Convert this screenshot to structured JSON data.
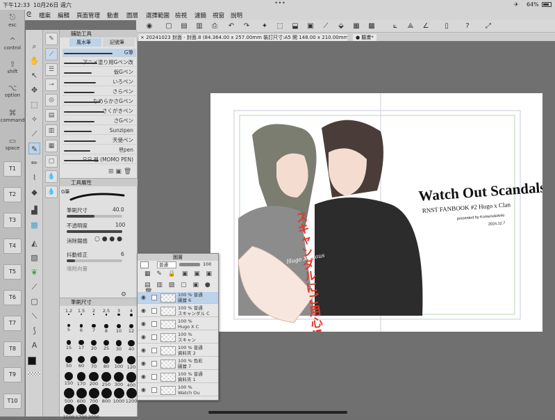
{
  "status": {
    "time": "下午12:33",
    "date": "10月26日 週六",
    "battery": "64%"
  },
  "menu": [
    "檔案",
    "編輯",
    "頁面管理",
    "動畫",
    "圖層",
    "選擇範圍",
    "檢視",
    "濾鏡",
    "視窗",
    "說明"
  ],
  "edge": {
    "esc": "esc",
    "control": "control",
    "shift": "shift",
    "option": "option",
    "command": "command",
    "space": "space",
    "t_buttons": [
      "T1",
      "T2",
      "T3",
      "T4",
      "T5",
      "T6",
      "T7",
      "T8",
      "T9",
      "T10"
    ]
  },
  "tab": {
    "title": "× 20241023 封面 - 封面.8 (84.364.00 x 257.00mm 裝訂尺寸:A5 開 148.00 x 210.00mm 350dpi 33.4%)",
    "nav": "● 聽畫*"
  },
  "brush_panel": {
    "header_tabs": [
      "輔助工具"
    ],
    "subtabs": [
      "風水筆",
      "記號筆"
    ],
    "items": [
      "G筆",
      "アニメ塗り用Gペン改",
      "仮Gペン",
      "いろペン",
      "さらペン",
      "なめらかさGペン",
      "さくがきペン",
      "さGペン",
      "Sunzipen",
      "天使ペン",
      "펜pen",
      "오모 펜 (MOMO PEN)"
    ]
  },
  "props": {
    "header": "工具屬性",
    "brush_name": "G筆",
    "size_label": "筆刷尺寸",
    "size_value": "40.0",
    "opacity_label": "不透明度",
    "opacity_value": "100",
    "aa_label": "消除鋸齒",
    "stab_label": "抖動修正",
    "stab_value": "6",
    "dir_label": "噴附向量"
  },
  "size_panel": {
    "header": "筆刷尺寸",
    "sizes": [
      "1.2",
      "1.5",
      "2",
      "2.5",
      "3",
      "4",
      "5",
      "6",
      "7",
      "8",
      "10",
      "12",
      "15",
      "17",
      "20",
      "25",
      "30",
      "40",
      "50",
      "60",
      "70",
      "80",
      "100",
      "120",
      "150",
      "170",
      "200",
      "250",
      "300",
      "400",
      "500",
      "600",
      "700",
      "800",
      "1000",
      "1200",
      "1500",
      "1700",
      "2000"
    ]
  },
  "layers": {
    "header": "圖層",
    "blend": "普通",
    "opacity": "100",
    "rows": [
      {
        "line1": "100 % 普通",
        "line2": "圖層 6",
        "selected": true
      },
      {
        "line1": "100 % 普通",
        "line2": "スキャンダル C",
        "selected": false
      },
      {
        "line1": "100 %",
        "line2": "Hugo X C",
        "selected": false
      },
      {
        "line1": "100 %",
        "line2": "スキャン",
        "selected": false
      },
      {
        "line1": "100 % 普通",
        "line2": "資料夾 2",
        "selected": false
      },
      {
        "line1": "100 % 色彩",
        "line2": "圖層 7",
        "selected": false
      },
      {
        "line1": "100 % 普通",
        "line2": "資料夾 1",
        "selected": false
      },
      {
        "line1": "100 %",
        "line2": "Watch Ou",
        "selected": false
      }
    ]
  },
  "cover": {
    "title": "Watch Out Scandals!!",
    "subtitle": "RNST FANBOOK #2 Hugo x Clan",
    "credit": "presented by KomenukiAnki",
    "date": "2024.12.7",
    "jp_title": "スキャンダルにご用心!!",
    "signature": "Hugo X Claus"
  },
  "colors": {
    "accent_red": "#e03a2a",
    "select_blue": "#bcd3ea",
    "paper": "#ffffff",
    "ui_gray": "#d4d4d4"
  }
}
